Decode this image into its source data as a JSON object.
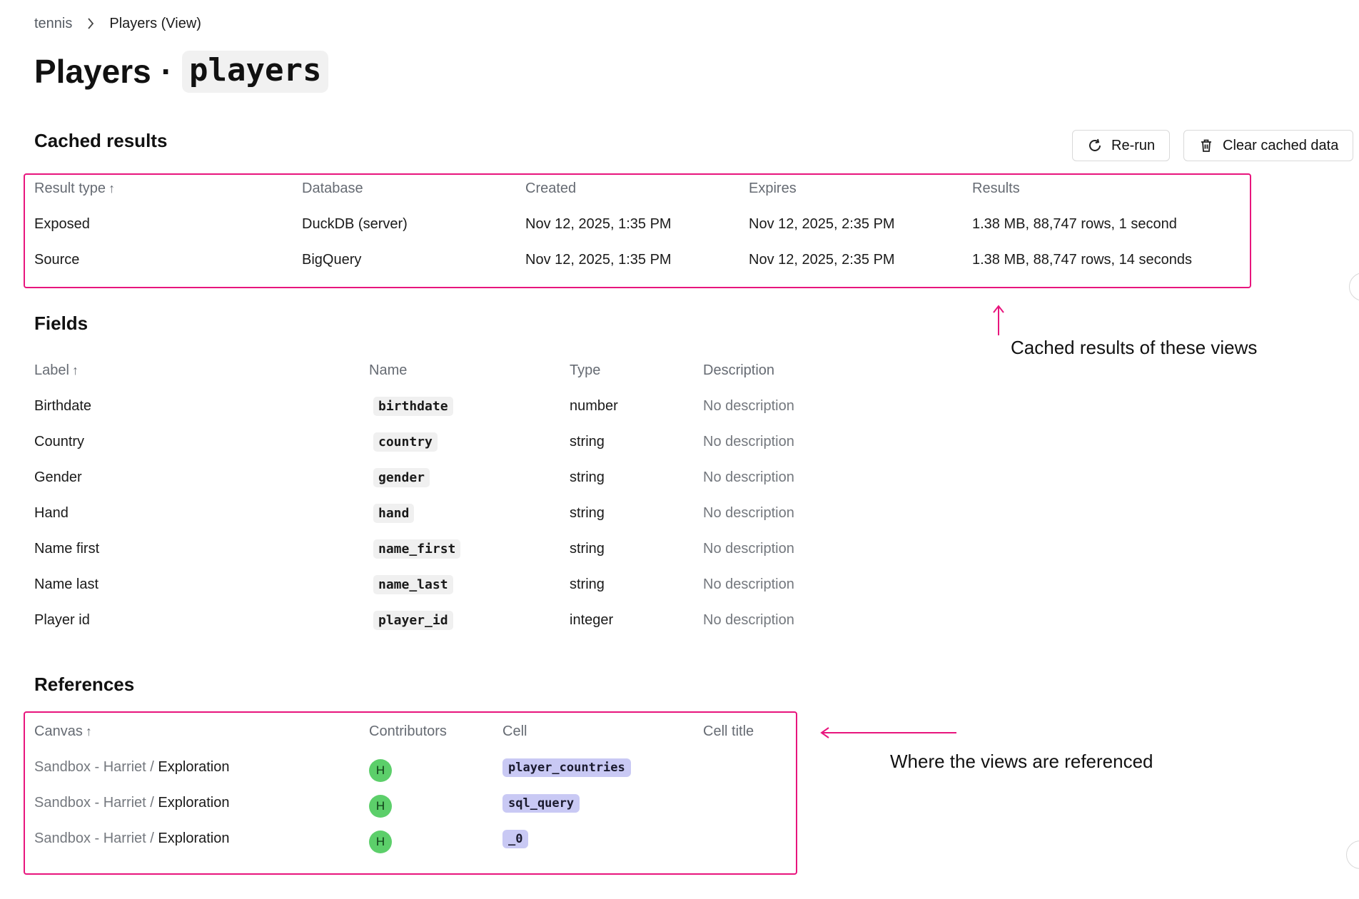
{
  "breadcrumb": {
    "root": "tennis",
    "current": "Players (View)"
  },
  "title": {
    "name": "Players",
    "separator": "·",
    "code": "players"
  },
  "cached": {
    "heading": "Cached results",
    "rerun_label": "Re-run",
    "clear_label": "Clear cached data",
    "columns": [
      "Result type",
      "Database",
      "Created",
      "Expires",
      "Results"
    ],
    "rows": [
      [
        "Exposed",
        "DuckDB (server)",
        "Nov 12, 2025, 1:35 PM",
        "Nov 12, 2025, 2:35 PM",
        "1.38 MB, 88,747 rows, 1 second"
      ],
      [
        "Source",
        "BigQuery",
        "Nov 12, 2025, 1:35 PM",
        "Nov 12, 2025, 2:35 PM",
        "1.38 MB, 88,747 rows, 14 seconds"
      ]
    ]
  },
  "fields": {
    "heading": "Fields",
    "columns": [
      "Label",
      "Name",
      "Type",
      "Description"
    ],
    "rows": [
      [
        "Birthdate",
        "birthdate",
        "number",
        "No description"
      ],
      [
        "Country",
        "country",
        "string",
        "No description"
      ],
      [
        "Gender",
        "gender",
        "string",
        "No description"
      ],
      [
        "Hand",
        "hand",
        "string",
        "No description"
      ],
      [
        "Name first",
        "name_first",
        "string",
        "No description"
      ],
      [
        "Name last",
        "name_last",
        "string",
        "No description"
      ],
      [
        "Player id",
        "player_id",
        "integer",
        "No description"
      ]
    ]
  },
  "references": {
    "heading": "References",
    "columns": [
      "Canvas",
      "Contributors",
      "Cell",
      "Cell title"
    ],
    "rows": [
      {
        "canvas_prefix": "Sandbox - Harriet / ",
        "canvas_name": "Exploration",
        "contributor": "H",
        "cell": "player_countries",
        "cell_title": ""
      },
      {
        "canvas_prefix": "Sandbox - Harriet / ",
        "canvas_name": "Exploration",
        "contributor": "H",
        "cell": "sql_query",
        "cell_title": ""
      },
      {
        "canvas_prefix": "Sandbox - Harriet / ",
        "canvas_name": "Exploration",
        "contributor": "H",
        "cell": "_0",
        "cell_title": ""
      }
    ]
  },
  "annotations": {
    "cached_note": "Cached results of these views",
    "references_note": "Where the views are referenced"
  },
  "colors": {
    "highlight": "#e8157d",
    "avatar": "#5ccf6a",
    "cell_pill": "#c9c9f4"
  },
  "icons": {
    "rerun": "refresh-icon",
    "clear": "trash-icon",
    "sort": "arrow-up-icon",
    "breadcrumb": "chevron-right-icon"
  }
}
